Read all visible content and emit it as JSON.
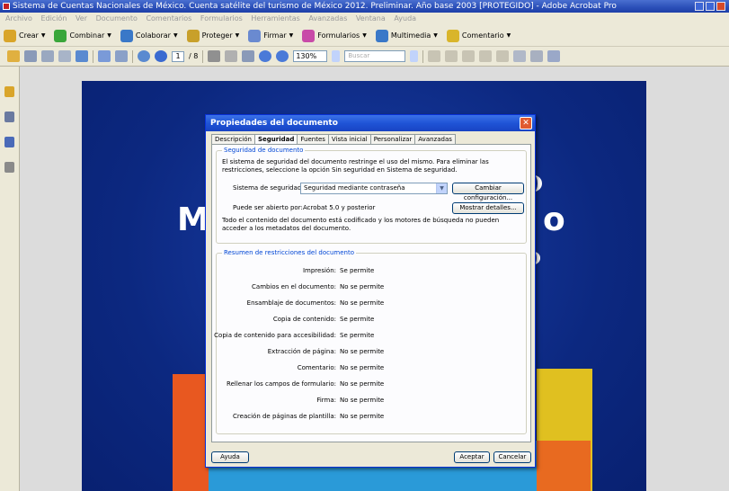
{
  "window": {
    "title": "Sistema de Cuentas Nacionales de México. Cuenta satélite del turismo de México 2012. Preliminar. Año base 2003 [PROTEGIDO] - Adobe Acrobat Pro"
  },
  "menubar": {
    "items": [
      "Archivo",
      "Edición",
      "Ver",
      "Documento",
      "Comentarios",
      "Formularios",
      "Herramientas",
      "Avanzadas",
      "Ventana",
      "Ayuda"
    ]
  },
  "toolbar": {
    "items": [
      {
        "label": "Crear",
        "color": "#d9a52a"
      },
      {
        "label": "Combinar",
        "color": "#3aa63a"
      },
      {
        "label": "Colaborar",
        "color": "#3a78c8"
      },
      {
        "label": "Proteger",
        "color": "#c8a02a"
      },
      {
        "label": "Firmar",
        "color": "#6a8ad0"
      },
      {
        "label": "Formularios",
        "color": "#c84aa8"
      },
      {
        "label": "Multimedia",
        "color": "#3a78c8"
      },
      {
        "label": "Comentario",
        "color": "#d9b52a"
      }
    ]
  },
  "navbar": {
    "page_current": "1",
    "page_total": "/ 8",
    "zoom": "130%",
    "search_placeholder": "Buscar"
  },
  "document": {
    "visible_letters": [
      "M",
      "o"
    ]
  },
  "dialog": {
    "title": "Propiedades del documento",
    "close_glyph": "✕",
    "tabs": [
      "Descripción",
      "Seguridad",
      "Fuentes",
      "Vista inicial",
      "Personalizar",
      "Avanzadas"
    ],
    "active_tab": "Seguridad",
    "security": {
      "group_title": "Seguridad de documento",
      "description": "El sistema de seguridad del documento restringe el uso del mismo. Para eliminar las restricciones, seleccione la opción Sin seguridad en Sistema de seguridad.",
      "method_label": "Sistema de seguridad:",
      "method_value": "Seguridad mediante contraseña",
      "change_settings_button": "Cambiar configuración...",
      "opened_by_label": "Puede ser abierto por:",
      "opened_by_value": "Acrobat 5.0 y posterior",
      "show_details_button": "Mostrar detalles...",
      "encryption_note": "Todo el contenido del documento está codificado y los motores de búsqueda no pueden acceder a los metadatos del documento."
    },
    "restrictions": {
      "group_title": "Resumen de restricciones del documento",
      "rows": [
        {
          "label": "Impresión:",
          "value": "Se permite"
        },
        {
          "label": "Cambios en el documento:",
          "value": "No se permite"
        },
        {
          "label": "Ensamblaje de documentos:",
          "value": "No se permite"
        },
        {
          "label": "Copia de contenido:",
          "value": "Se permite"
        },
        {
          "label": "Copia de contenido para accesibilidad:",
          "value": "Se permite"
        },
        {
          "label": "Extracción de página:",
          "value": "No se permite"
        },
        {
          "label": "Comentario:",
          "value": "No se permite"
        },
        {
          "label": "Rellenar los campos de formulario:",
          "value": "No se permite"
        },
        {
          "label": "Firma:",
          "value": "No se permite"
        },
        {
          "label": "Creación de páginas de plantilla:",
          "value": "No se permite"
        }
      ]
    },
    "buttons": {
      "help": "Ayuda",
      "ok": "Aceptar",
      "cancel": "Cancelar"
    }
  }
}
